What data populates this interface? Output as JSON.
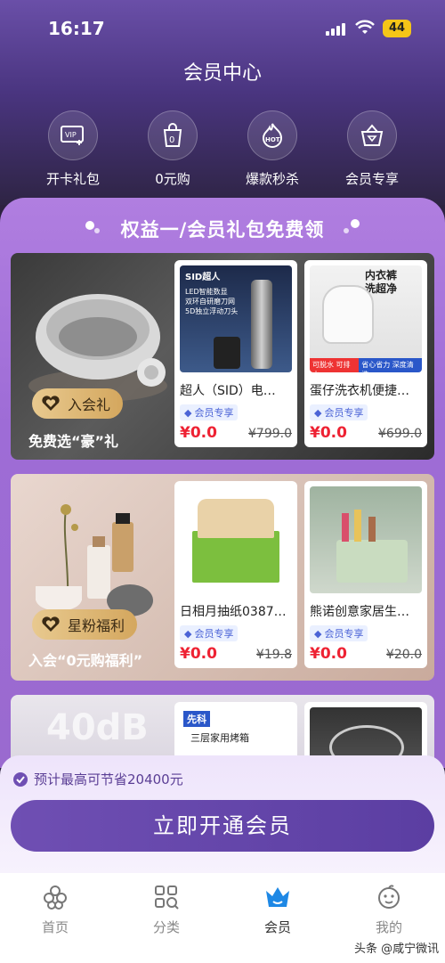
{
  "status": {
    "time": "16:17",
    "battery": "44"
  },
  "header": {
    "title": "会员中心"
  },
  "quick_actions": [
    {
      "label": "开卡礼包",
      "icon": "vip-card-icon"
    },
    {
      "label": "0元购",
      "icon": "zero-bag-icon"
    },
    {
      "label": "爆款秒杀",
      "icon": "hot-flame-icon"
    },
    {
      "label": "会员专享",
      "icon": "basket-gem-icon"
    }
  ],
  "section": {
    "title": "权益一/会员礼包免费领"
  },
  "cards": [
    {
      "badge": "入会礼",
      "caption": "免费选“豪”礼",
      "products": [
        {
          "name": "超人（SID）电…",
          "tag": "会员专享",
          "price": "¥0.0",
          "old_price": "¥799.0",
          "img_lines": [
            "SID超人",
            "LED智能数显",
            "双环自研磨刀网",
            "5D独立浮动刀头"
          ]
        },
        {
          "name": "蛋仔洗衣机便捷…",
          "tag": "会员专享",
          "price": "¥0.0",
          "old_price": "¥699.0",
          "img_lines": [
            "内衣裤",
            "洗超净",
            "可脱水 可排水",
            "省心省力 深度清洗"
          ]
        }
      ]
    },
    {
      "badge": "星粉福利",
      "caption": "入会“0元购福利”",
      "products": [
        {
          "name": "日相月抽纸0387…",
          "tag": "会员专享",
          "price": "¥0.0",
          "old_price": "¥19.8"
        },
        {
          "name": "熊诺创意家居生…",
          "tag": "会员专享",
          "price": "¥0.0",
          "old_price": "¥20.0"
        }
      ]
    },
    {
      "bg_text": "40dB",
      "products": [
        {
          "img_lines": [
            "先科",
            "三层家用烤箱"
          ]
        },
        {}
      ]
    }
  ],
  "save": {
    "text": "预计最高可节省20400元"
  },
  "cta": {
    "label": "立即开通会员"
  },
  "tabs": [
    {
      "label": "首页",
      "icon": "home-flower-icon"
    },
    {
      "label": "分类",
      "icon": "category-grid-icon"
    },
    {
      "label": "会员",
      "icon": "member-crown-icon",
      "active": true
    },
    {
      "label": "我的",
      "icon": "profile-face-icon"
    }
  ],
  "watermark": "头条 @咸宁微讯",
  "colors": {
    "accent": "#6f4fb3",
    "price": "#ee2233",
    "tag_text": "#4b63d6",
    "badge_gold": "#d4a75e"
  }
}
